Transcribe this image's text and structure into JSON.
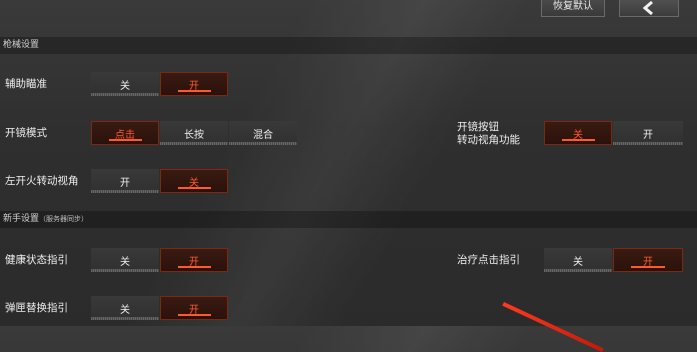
{
  "header": {
    "reset_label": "恢复默认",
    "back_icon": "chevron-left-icon"
  },
  "sections": [
    {
      "title": "枪械设置",
      "rows": [
        {
          "label": "辅助瞄准",
          "options": [
            "关",
            "开"
          ],
          "selected": "开"
        },
        {
          "label": "开镜模式",
          "options": [
            "点击",
            "长按",
            "混合"
          ],
          "selected": "点击"
        },
        {
          "label": "开镜按钮转动视角功能",
          "label_lines": [
            "开镜按钮",
            "转动视角功能"
          ],
          "options": [
            "关",
            "开"
          ],
          "selected": "关"
        },
        {
          "label": "左开火转动视角",
          "options": [
            "开",
            "关"
          ],
          "selected": "关"
        }
      ]
    },
    {
      "title": "新手设置",
      "subtitle": "（服务器同步）",
      "rows": [
        {
          "label": "健康状态指引",
          "options": [
            "关",
            "开"
          ],
          "selected": "开"
        },
        {
          "label": "治疗点击指引",
          "options": [
            "关",
            "开"
          ],
          "selected": "开"
        },
        {
          "label": "弹匣替换指引",
          "options": [
            "关",
            "开"
          ],
          "selected": "开"
        }
      ]
    }
  ],
  "colors": {
    "accent": "#ff5a2a",
    "active_bg": "#2f160e",
    "inactive_bg": "#343434"
  }
}
